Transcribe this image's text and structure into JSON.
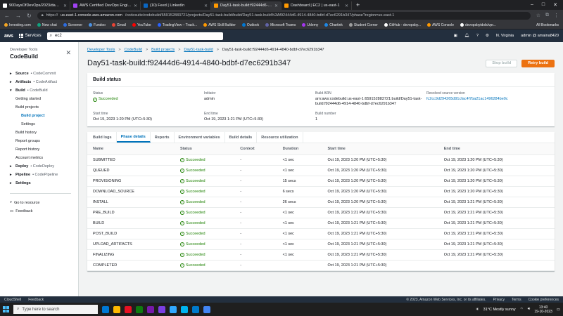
{
  "browser": {
    "tabs": [
      {
        "title": "90DaysOfDevOps/2023/day51/I",
        "color": "#ffffff",
        "active": false
      },
      {
        "title": "AWS Certified DevOps Enginee",
        "color": "#a142f4",
        "active": false
      },
      {
        "title": "(10) Feed | LinkedIn",
        "color": "#0a66c2",
        "active": false
      },
      {
        "title": "Day51-task-build:f92444d6-4914",
        "color": "#ff9900",
        "active": true
      },
      {
        "title": "Dashboard | EC2 | us-east-1",
        "color": "#ff9900",
        "active": false
      }
    ],
    "new_tab": "+",
    "url_prefix": "https://",
    "url_host": "us-east-1.console.aws.amazon.com",
    "url_path": "/codesuite/codebuild/659152883721/projects/Day51-task-build/build/Day51-task-build%3Af92444d6-4914-4840-bdbf-d7ec6291b347/phase?region=us-east-1",
    "bookmarks": [
      {
        "label": "Investing.com",
        "color": "#f5a623"
      },
      {
        "label": "New chat",
        "color": "#10a37f"
      },
      {
        "label": "Screener",
        "color": "#2d6cdf"
      },
      {
        "label": "Fundoo",
        "color": "#4a90e2"
      },
      {
        "label": "Gmail",
        "color": "#ea4335"
      },
      {
        "label": "YouTube",
        "color": "#ff0000"
      },
      {
        "label": "TradingView – Track...",
        "color": "#2962ff"
      },
      {
        "label": "AWS Skill Builder",
        "color": "#ff9900"
      },
      {
        "label": "Outlook",
        "color": "#0078d4"
      },
      {
        "label": "Microsoft Teams",
        "color": "#6264a7"
      },
      {
        "label": "Udemy",
        "color": "#a435f0"
      },
      {
        "label": "Chartink",
        "color": "#1e88e5"
      },
      {
        "label": "Student Corner",
        "color": "#9e9e9e"
      },
      {
        "label": "GitHub - devopsby...",
        "color": "#ffffff"
      },
      {
        "label": "AWS Console",
        "color": "#ff9900"
      },
      {
        "label": "devopsbyidols/vpr...",
        "color": "#ffffff"
      }
    ],
    "all_bookmarks": "All Bookmarks"
  },
  "aws_nav": {
    "logo": "aws",
    "services": "Services",
    "search_value": "ec2",
    "region": "N. Virginia",
    "account": "admin @ amaina8420"
  },
  "sidebar": {
    "kicker": "Developer Tools",
    "title": "CodeBuild",
    "items": [
      {
        "label": "Source",
        "muted": "• CodeCommit",
        "kind": "section",
        "caret": "▸"
      },
      {
        "label": "Artifacts",
        "muted": "• CodeArtifact",
        "kind": "section",
        "caret": "▸"
      },
      {
        "label": "Build",
        "muted": "• CodeBuild",
        "kind": "section",
        "caret": "▾"
      },
      {
        "label": "Getting started",
        "muted": "",
        "kind": "sub",
        "caret": ""
      },
      {
        "label": "Build projects",
        "muted": "",
        "kind": "sub",
        "caret": ""
      },
      {
        "label": "Build project",
        "muted": "",
        "kind": "sub2 active",
        "caret": ""
      },
      {
        "label": "Settings",
        "muted": "",
        "kind": "sub2",
        "caret": ""
      },
      {
        "label": "Build history",
        "muted": "",
        "kind": "sub",
        "caret": ""
      },
      {
        "label": "Report groups",
        "muted": "",
        "kind": "sub",
        "caret": ""
      },
      {
        "label": "Report history",
        "muted": "",
        "kind": "sub",
        "caret": ""
      },
      {
        "label": "Account metrics",
        "muted": "",
        "kind": "sub",
        "caret": ""
      },
      {
        "label": "Deploy",
        "muted": "• CodeDeploy",
        "kind": "section",
        "caret": "▸"
      },
      {
        "label": "Pipeline",
        "muted": "• CodePipeline",
        "kind": "section",
        "caret": "▸"
      },
      {
        "label": "Settings",
        "muted": "",
        "kind": "section",
        "caret": "▸"
      }
    ],
    "goto_resource": "Go to resource",
    "feedback": "Feedback"
  },
  "breadcrumbs": [
    "Developer Tools",
    "CodeBuild",
    "Build projects",
    "Day51-task-build"
  ],
  "breadcrumb_current": "Day51-task-build:f92444d6-4914-4840-bdbf-d7ec6291b347",
  "page_title": "Day51-task-build:f92444d6-4914-4840-bdbf-d7ec6291b347",
  "actions": {
    "stop": "Stop build",
    "retry": "Retry build"
  },
  "build_status": {
    "heading": "Build status",
    "fields": [
      {
        "label": "Status",
        "value": "Succeeded",
        "type": "status"
      },
      {
        "label": "Initiator",
        "value": "admin",
        "type": "text"
      },
      {
        "label": "Build ARN",
        "value": "arn:aws:codebuild:us-east-1:659152883721:build/Day51-task-build:f92444d6-4914-4840-bdbf-d7ec6291b347",
        "type": "text"
      },
      {
        "label": "Resolved source version",
        "value": "fc2cc9d294265d91cfac4f7ba21ac1496284be0c",
        "type": "link"
      },
      {
        "label": "Start time",
        "value": "Oct 19, 2023 1:20 PM (UTC+5:30)",
        "type": "text"
      },
      {
        "label": "End time",
        "value": "Oct 19, 2023 1:21 PM (UTC+5:30)",
        "type": "text"
      },
      {
        "label": "Build number",
        "value": "1",
        "type": "text"
      }
    ]
  },
  "tabs": [
    {
      "label": "Build logs",
      "active": false
    },
    {
      "label": "Phase details",
      "active": true
    },
    {
      "label": "Reports",
      "active": false
    },
    {
      "label": "Environment variables",
      "active": false
    },
    {
      "label": "Build details",
      "active": false
    },
    {
      "label": "Resource utilization",
      "active": false
    }
  ],
  "phase_table": {
    "columns": [
      "Name",
      "Status",
      "Context",
      "Duration",
      "Start time",
      "End time"
    ],
    "rows": [
      {
        "name": "SUBMITTED",
        "status": "Succeeded",
        "context": "-",
        "duration": "<1 sec",
        "start": "Oct 19, 2023 1:20 PM (UTC+5:30)",
        "end": "Oct 19, 2023 1:20 PM (UTC+5:30)"
      },
      {
        "name": "QUEUED",
        "status": "Succeeded",
        "context": "-",
        "duration": "<1 sec",
        "start": "Oct 19, 2023 1:20 PM (UTC+5:30)",
        "end": "Oct 19, 2023 1:20 PM (UTC+5:30)"
      },
      {
        "name": "PROVISIONING",
        "status": "Succeeded",
        "context": "-",
        "duration": "15 secs",
        "start": "Oct 19, 2023 1:20 PM (UTC+5:30)",
        "end": "Oct 19, 2023 1:20 PM (UTC+5:30)"
      },
      {
        "name": "DOWNLOAD_SOURCE",
        "status": "Succeeded",
        "context": "-",
        "duration": "6 secs",
        "start": "Oct 19, 2023 1:20 PM (UTC+5:30)",
        "end": "Oct 19, 2023 1:20 PM (UTC+5:30)"
      },
      {
        "name": "INSTALL",
        "status": "Succeeded",
        "context": "-",
        "duration": "26 secs",
        "start": "Oct 19, 2023 1:20 PM (UTC+5:30)",
        "end": "Oct 19, 2023 1:21 PM (UTC+5:30)"
      },
      {
        "name": "PRE_BUILD",
        "status": "Succeeded",
        "context": "-",
        "duration": "<1 sec",
        "start": "Oct 19, 2023 1:21 PM (UTC+5:30)",
        "end": "Oct 19, 2023 1:21 PM (UTC+5:30)"
      },
      {
        "name": "BUILD",
        "status": "Succeeded",
        "context": "-",
        "duration": "<1 sec",
        "start": "Oct 19, 2023 1:21 PM (UTC+5:30)",
        "end": "Oct 19, 2023 1:21 PM (UTC+5:30)"
      },
      {
        "name": "POST_BUILD",
        "status": "Succeeded",
        "context": "-",
        "duration": "<1 sec",
        "start": "Oct 19, 2023 1:21 PM (UTC+5:30)",
        "end": "Oct 19, 2023 1:21 PM (UTC+5:30)"
      },
      {
        "name": "UPLOAD_ARTIFACTS",
        "status": "Succeeded",
        "context": "-",
        "duration": "<1 sec",
        "start": "Oct 19, 2023 1:21 PM (UTC+5:30)",
        "end": "Oct 19, 2023 1:21 PM (UTC+5:30)"
      },
      {
        "name": "FINALIZING",
        "status": "Succeeded",
        "context": "-",
        "duration": "<1 sec",
        "start": "Oct 19, 2023 1:21 PM (UTC+5:30)",
        "end": "Oct 19, 2023 1:21 PM (UTC+5:30)"
      },
      {
        "name": "COMPLETED",
        "status": "Succeeded",
        "context": "-",
        "duration": "",
        "start": "Oct 19, 2023 1:21 PM (UTC+5:30)",
        "end": ""
      }
    ]
  },
  "footer": {
    "cloudshell": "CloudShell",
    "feedback": "Feedback",
    "copyright": "© 2023, Amazon Web Services, Inc. or its affiliates.",
    "privacy": "Privacy",
    "terms": "Terms",
    "cookies": "Cookie preferences"
  },
  "taskbar": {
    "search_placeholder": "Type here to search",
    "weather": "31°C  Mostly sunny",
    "time": "13:40",
    "date": "19-10-2023",
    "apps": [
      "#0078d4",
      "#ffb900",
      "#e81123",
      "#0f7b0f",
      "#7719aa",
      "#7b3fe4",
      "#31a8ff",
      "#00b4f0",
      "#007acc",
      "#4285f4"
    ]
  }
}
